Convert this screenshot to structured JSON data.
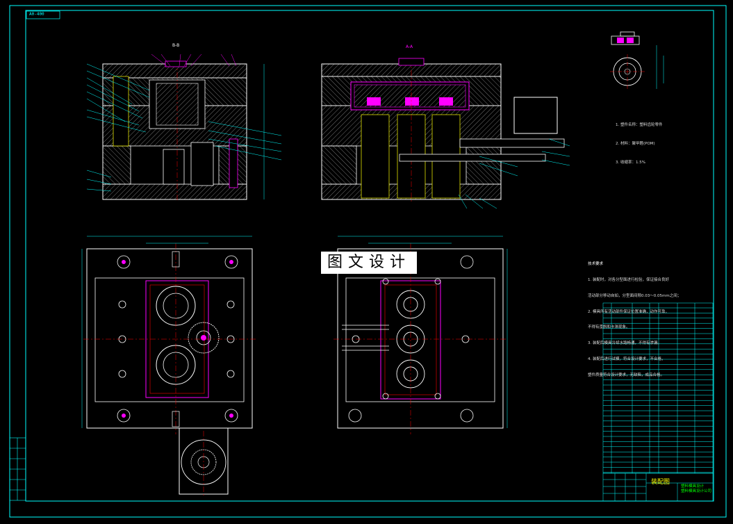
{
  "drawing": {
    "sheet_id": "A0-400",
    "watermark": "图文设计",
    "section_left": "B-B",
    "section_right": "A-A",
    "title_block_name": "装配图",
    "title_block_sub_1": "塑料模具设计",
    "title_block_sub_2": "塑料模具设计公司"
  },
  "part_spec": {
    "lines": [
      "1. 塑件名称：塑料齿轮零件",
      "2. 材料：聚甲醛(POM)",
      "3. 收缩率：1.5%"
    ]
  },
  "tech_requirements": {
    "title": "技术要求",
    "lines": [
      "1. 装配时，对各分型面进行检验，保证接合良好",
      "活动部分移动自如，分型面间隙0.03～0.05mm之间；",
      "2. 模具所有活动部件保证位置准确，动作可靠，",
      "不得有歪斜和卡滞现象。",
      "3. 装配后模具冷却水路畅通，不得有渗漏。",
      "4. 装配后进行试模，符合设计要求，不合格，",
      "塑件质量符合设计要求，无缺陷，成品合格。"
    ]
  },
  "colors": {
    "outline": "#ffffff",
    "border": "#00ffff",
    "hatch": "#ffffff",
    "magenta": "#ff00ff",
    "cyan": "#00ffff",
    "green": "#00ff00",
    "yellow": "#ffff00",
    "red": "#ff0000"
  },
  "icons": {
    "callout_bubble": "leader-balloon-icon"
  }
}
